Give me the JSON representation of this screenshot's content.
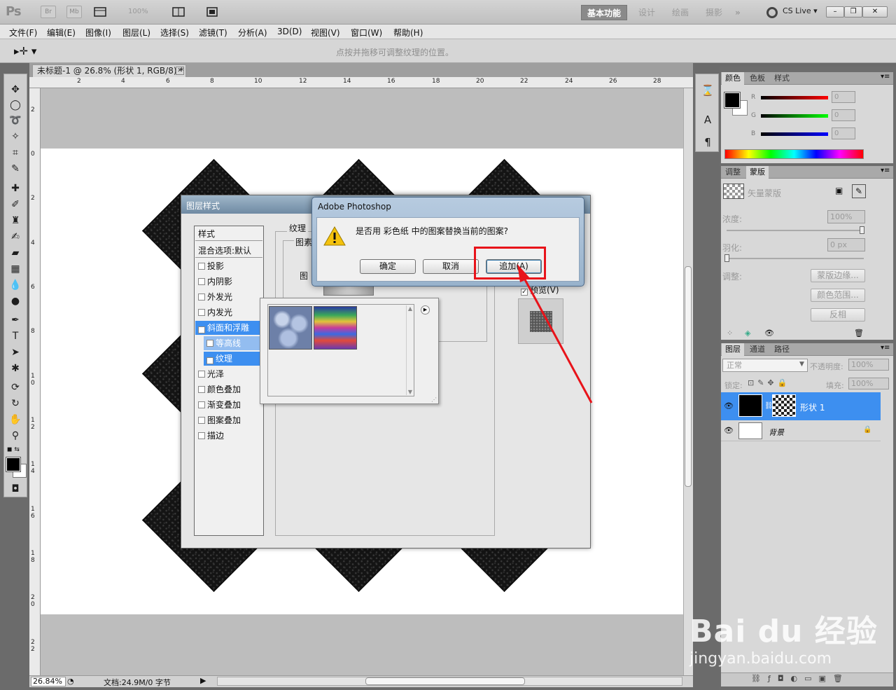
{
  "app": {
    "logo": "Ps",
    "zoom_level": "100%",
    "workspaces": [
      "基本功能",
      "设计",
      "绘画",
      "摄影"
    ],
    "more_workspaces": "»",
    "cs_live": "CS Live ▾",
    "btn_br": "Br",
    "btn_mb": "Mb"
  },
  "menu": [
    "文件(F)",
    "编辑(E)",
    "图像(I)",
    "图层(L)",
    "选择(S)",
    "滤镜(T)",
    "分析(A)",
    "3D(D)",
    "视图(V)",
    "窗口(W)",
    "帮助(H)"
  ],
  "options": {
    "hint": "点按并拖移可调整纹理的位置。"
  },
  "document": {
    "tab_title": "未标题-1 @ 26.8% (形状 1, RGB/8) *",
    "ruler_h": [
      "2",
      "4",
      "6",
      "8",
      "10",
      "12",
      "14",
      "16",
      "18",
      "20",
      "22",
      "24",
      "26",
      "28"
    ],
    "ruler_v": [
      "2",
      "0",
      "2",
      "4",
      "6",
      "8",
      "1\n0",
      "1\n2",
      "1\n4",
      "1\n6",
      "1\n8",
      "2\n0",
      "2\n2"
    ],
    "zoom": "26.84%",
    "doc_info": "文档:24.9M/0 字节"
  },
  "panels": {
    "color_tabs": [
      "颜色",
      "色板",
      "样式"
    ],
    "rgb": [
      {
        "label": "R",
        "value": "0"
      },
      {
        "label": "G",
        "value": "0"
      },
      {
        "label": "B",
        "value": "0"
      }
    ],
    "mask_tabs": [
      "调整",
      "蒙版"
    ],
    "mask": {
      "title": "矢量蒙版",
      "density_label": "浓度:",
      "density_value": "100%",
      "feather_label": "羽化:",
      "feather_value": "0 px",
      "adjust_label": "调整:",
      "btn_edge": "蒙版边缘...",
      "btn_range": "颜色范围...",
      "btn_invert": "反相"
    },
    "layer_tabs": [
      "图层",
      "通道",
      "路径"
    ],
    "layers": {
      "blend_mode": "正常",
      "opacity_label": "不透明度:",
      "opacity_value": "100%",
      "lock_label": "锁定:",
      "fill_label": "填充:",
      "fill_value": "100%",
      "items": [
        {
          "name": "形状 1"
        },
        {
          "name": "背景"
        }
      ]
    }
  },
  "layer_style": {
    "title": "图层样式",
    "styles_header": "样式",
    "blend_default": "混合选项:默认",
    "items": [
      {
        "label": "投影",
        "checked": false
      },
      {
        "label": "内阴影",
        "checked": false
      },
      {
        "label": "外发光",
        "checked": false
      },
      {
        "label": "内发光",
        "checked": false
      },
      {
        "label": "斜面和浮雕",
        "checked": true
      },
      {
        "label": "等高线",
        "checked": false
      },
      {
        "label": "纹理",
        "checked": true
      },
      {
        "label": "光泽",
        "checked": false
      },
      {
        "label": "颜色叠加",
        "checked": false
      },
      {
        "label": "渐变叠加",
        "checked": false
      },
      {
        "label": "图案叠加",
        "checked": false
      },
      {
        "label": "描边",
        "checked": false
      }
    ],
    "group_label": "纹理",
    "sub_label": "图素",
    "pattern_label": "图",
    "preview_label": "预览(V)"
  },
  "confirm": {
    "title": "Adobe Photoshop",
    "message": "是否用 彩色纸 中的图案替换当前的图案?",
    "ok": "确定",
    "cancel": "取消",
    "append": "追加(A)"
  },
  "watermark": {
    "logo": "Bai du 经验",
    "url": "jingyan.baidu.com"
  },
  "colors": {
    "selection_blue": "#3d8ff0",
    "highlight_red": "#e8131a"
  }
}
